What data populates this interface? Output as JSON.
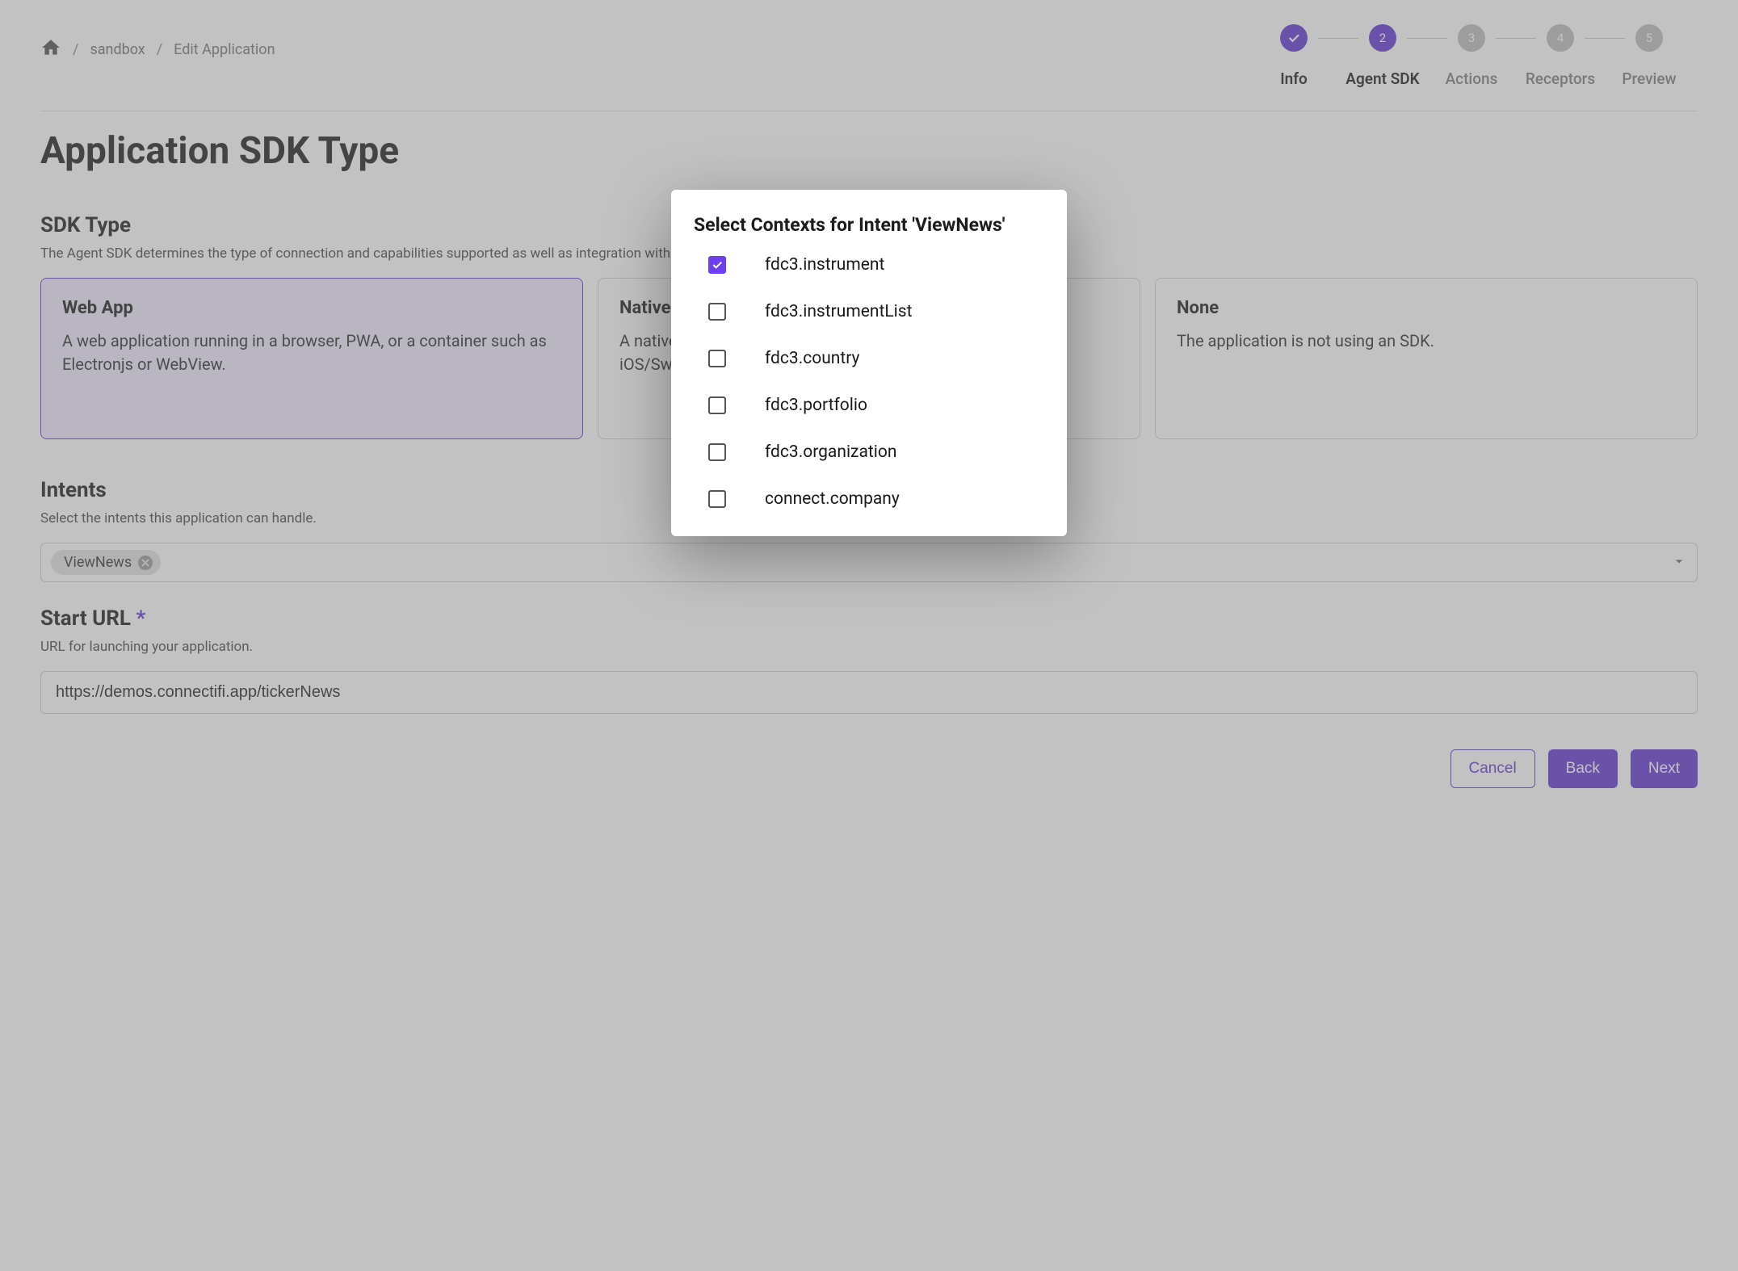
{
  "breadcrumb": {
    "items": [
      "sandbox",
      "Edit Application"
    ]
  },
  "stepper": {
    "steps": [
      {
        "label": "Info",
        "state": "done"
      },
      {
        "label": "Agent SDK",
        "state": "active",
        "num": "2"
      },
      {
        "label": "Actions",
        "state": "future",
        "num": "3"
      },
      {
        "label": "Receptors",
        "state": "future",
        "num": "4"
      },
      {
        "label": "Preview",
        "state": "future",
        "num": "5"
      }
    ]
  },
  "pageTitle": "Application SDK Type",
  "sdk": {
    "heading": "SDK Type",
    "sub": "The Agent SDK determines the type of connection and capabilities supported as well as integration with the end user experience in web, native, and mobile.",
    "cards": [
      {
        "title": "Web App",
        "body": "A web application running in a browser, PWA, or a container such as Electronjs or WebView.",
        "selected": true
      },
      {
        "title": "Native",
        "body": "A native application for desktop or mobile. e.g. .NET, Java, or iOS/Swift.",
        "selected": false
      },
      {
        "title": "None",
        "body": "The application is not using an SDK.",
        "selected": false
      }
    ]
  },
  "intents": {
    "heading": "Intents",
    "sub": "Select the intents this application can handle.",
    "chips": [
      "ViewNews"
    ]
  },
  "startUrl": {
    "heading": "Start URL",
    "required": "*",
    "sub": "URL for launching your application.",
    "value": "https://demos.connectifi.app/tickerNews"
  },
  "footer": {
    "cancel": "Cancel",
    "back": "Back",
    "next": "Next"
  },
  "modal": {
    "title": "Select Contexts for Intent 'ViewNews'",
    "options": [
      {
        "label": "fdc3.instrument",
        "checked": true
      },
      {
        "label": "fdc3.instrumentList",
        "checked": false
      },
      {
        "label": "fdc3.country",
        "checked": false
      },
      {
        "label": "fdc3.portfolio",
        "checked": false
      },
      {
        "label": "fdc3.organization",
        "checked": false
      },
      {
        "label": "connect.company",
        "checked": false
      }
    ]
  }
}
